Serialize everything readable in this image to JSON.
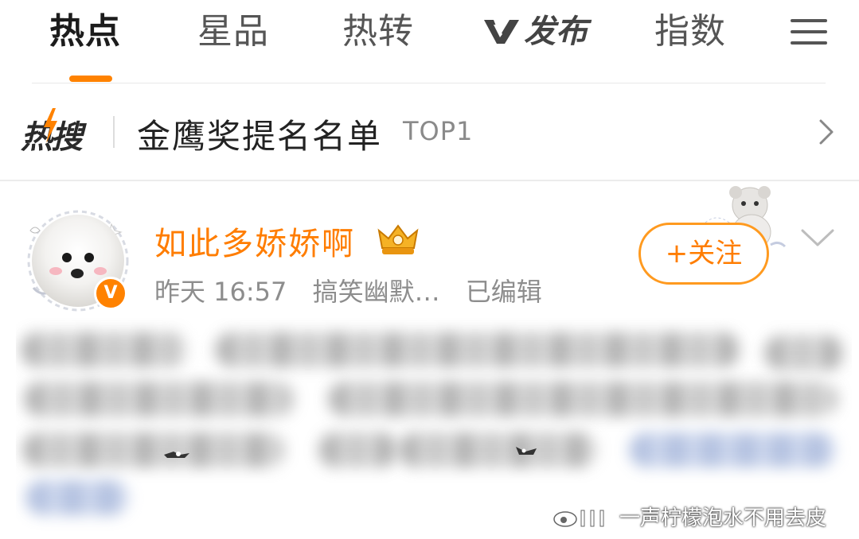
{
  "tabs": [
    {
      "label": "热点",
      "active": true
    },
    {
      "label": "星品",
      "active": false
    },
    {
      "label": "热转",
      "active": false
    },
    {
      "label": "发布",
      "active": false,
      "prefix_icon": "v-logo-icon"
    },
    {
      "label": "指数",
      "active": false
    }
  ],
  "menu_icon": "hamburger-menu-icon",
  "hot_search": {
    "logo_text": "热搜",
    "title": "金鹰奖提名名单",
    "rank": "TOP1",
    "chevron_icon": "chevron-right-icon"
  },
  "post": {
    "username": "如此多娇娇啊",
    "badge_icon": "crown-badge-icon",
    "verified_icon": "verified-v-icon",
    "verified_text": "V",
    "time": "昨天 16:57",
    "category": "搞笑幽默…",
    "edited": "已编辑",
    "follow_label": "+关注"
  },
  "watermark": {
    "text": "一声柠檬泡水不用去皮"
  },
  "colors": {
    "accent": "#ff8200",
    "username": "#ff7d00",
    "meta_gray": "#8d8d8d"
  }
}
